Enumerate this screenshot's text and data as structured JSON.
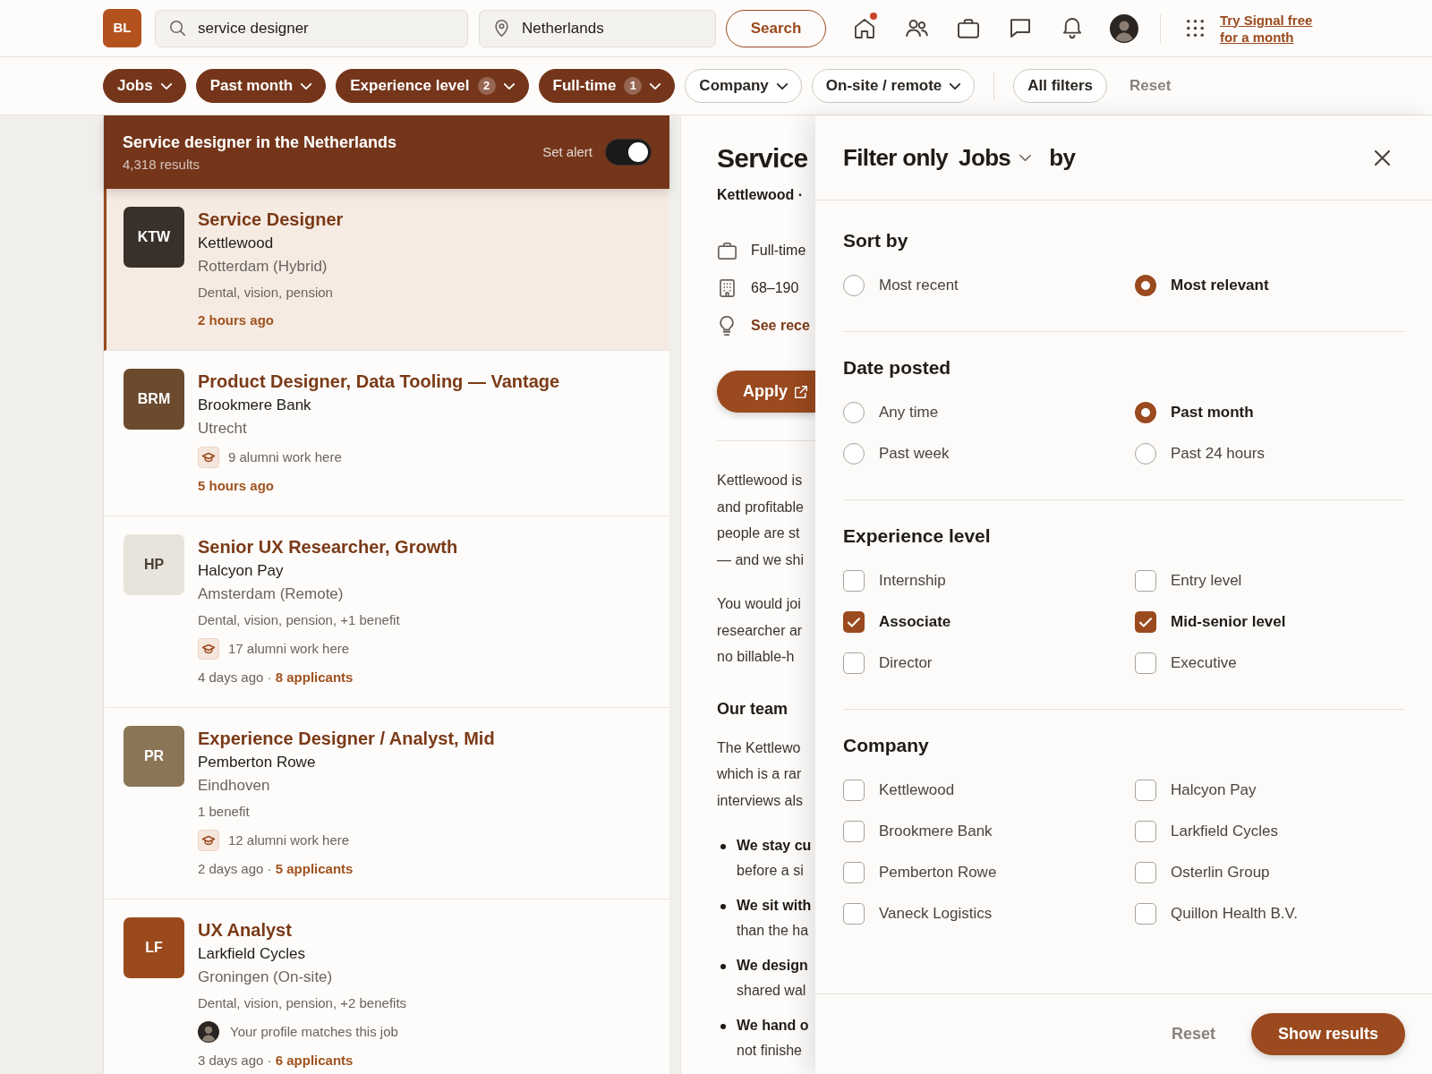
{
  "top_bar": {
    "logo": "BL",
    "search": {
      "value": "service designer"
    },
    "location": {
      "value": "Netherlands"
    },
    "search_button": "Search",
    "home_notification": true,
    "promo_link": "Try Signal free for a month"
  },
  "filter_bar": {
    "pills": [
      {
        "label": "Jobs",
        "active": true
      },
      {
        "label": "Past month",
        "active": true
      },
      {
        "label": "Experience level",
        "active": true,
        "count": "2"
      },
      {
        "label": "Full-time",
        "active": true,
        "count": "1"
      },
      {
        "label": "Company",
        "active": false
      },
      {
        "label": "On-site / remote",
        "active": false
      }
    ],
    "all_filters": "All filters",
    "reset": "Reset"
  },
  "results": {
    "title": "Service designer in the Netherlands",
    "count": "4,318 results",
    "alert": {
      "label": "Set alert",
      "on": true
    },
    "jobs": [
      {
        "logo": "KTW",
        "color": "#3a302a",
        "title": "Service Designer",
        "company": "Kettlewood",
        "location": "Rotterdam (Hybrid)",
        "benefits": "Dental, vision, pension",
        "meta": "2 hours ago",
        "recent": true,
        "selected": true
      },
      {
        "logo": "BRM",
        "color": "#6b4a2e",
        "title": "Product Designer, Data Tooling — Vantage",
        "company": "Brookmere Bank",
        "location": "Utrecht",
        "insight": {
          "kind": "alumni",
          "text": "9 alumni work here"
        },
        "meta": "5 hours ago",
        "recent": true,
        "selected": false
      },
      {
        "logo": "HP",
        "color": "#e8e4db",
        "title": "Senior UX Researcher, Growth",
        "company": "Halcyon Pay",
        "location": "Amsterdam (Remote)",
        "benefits": "Dental, vision, pension, +1 benefit",
        "insight": {
          "kind": "alumni",
          "text": "17 alumni work here"
        },
        "meta": "4 days ago · **8 applicants**",
        "recent": false,
        "selected": false
      },
      {
        "logo": "PR",
        "color": "#8a7556",
        "title": "Experience Designer / Analyst, Mid",
        "company": "Pemberton Rowe",
        "location": "Eindhoven",
        "benefits": "1 benefit",
        "insight": {
          "kind": "alumni",
          "text": "12 alumni work here"
        },
        "meta": "2 days ago · **5 applicants**",
        "recent": false,
        "selected": false
      },
      {
        "logo": "LF",
        "color": "#9b4a1e",
        "title": "UX Analyst",
        "company": "Larkfield Cycles",
        "location": "Groningen (On-site)",
        "benefits": "Dental, vision, pension, +2 benefits",
        "insight": {
          "kind": "profile_match",
          "text": "Your profile matches this job"
        },
        "meta": "3 days ago · **6 applicants**",
        "recent": false,
        "selected": false
      }
    ]
  },
  "detail": {
    "title": "Service",
    "company": "Kettlewood ·",
    "facts": [
      {
        "text": "Full-time",
        "kind": "plain"
      },
      {
        "text": "68–190",
        "kind": "plain"
      },
      {
        "text": "See rece",
        "kind": "link"
      }
    ],
    "apply": "Apply",
    "paragraphs": [
      [
        "Kettlewood is",
        "and profitable",
        "people are st",
        "— and we shi"
      ],
      [
        "You would joi",
        "researcher ar",
        "no billable-h"
      ]
    ],
    "team_heading": "Our team",
    "team_paragraph": [
      "The Kettlewo",
      "which is a rar",
      "interviews als"
    ],
    "bullets": [
      [
        "We stay cu",
        "before a si"
      ],
      [
        "We sit with",
        "than the ha"
      ],
      [
        "We design",
        "shared wal"
      ],
      [
        "We hand o",
        "not finishe"
      ]
    ]
  },
  "filter_panel": {
    "title": "Filter only",
    "scope": "Jobs",
    "title_end": "by",
    "sections": [
      {
        "title": "Sort by",
        "kind": "radio",
        "options": [
          {
            "label": "Most recent",
            "selected": false
          },
          {
            "label": "Most relevant",
            "selected": true
          }
        ]
      },
      {
        "title": "Date posted",
        "kind": "radio",
        "options": [
          {
            "label": "Any time",
            "selected": false
          },
          {
            "label": "Past month",
            "selected": true
          },
          {
            "label": "Past week",
            "selected": false
          },
          {
            "label": "Past 24 hours",
            "selected": false
          }
        ]
      },
      {
        "title": "Experience level",
        "kind": "checkbox",
        "options": [
          {
            "label": "Internship",
            "checked": false
          },
          {
            "label": "Entry level",
            "checked": false
          },
          {
            "label": "Associate",
            "checked": true
          },
          {
            "label": "Mid-senior level",
            "checked": true
          },
          {
            "label": "Director",
            "checked": false
          },
          {
            "label": "Executive",
            "checked": false
          }
        ]
      },
      {
        "title": "Company",
        "kind": "checkbox",
        "options": [
          {
            "label": "Kettlewood",
            "checked": false
          },
          {
            "label": "Halcyon Pay",
            "checked": false
          },
          {
            "label": "Brookmere Bank",
            "checked": false
          },
          {
            "label": "Larkfield Cycles",
            "checked": false
          },
          {
            "label": "Pemberton Rowe",
            "checked": false
          },
          {
            "label": "Osterlin Group",
            "checked": false
          },
          {
            "label": "Vaneck Logistics",
            "checked": false
          },
          {
            "label": "Quillon Health B.V.",
            "checked": false
          }
        ]
      }
    ],
    "reset": "Reset",
    "show_results": "Show results"
  }
}
